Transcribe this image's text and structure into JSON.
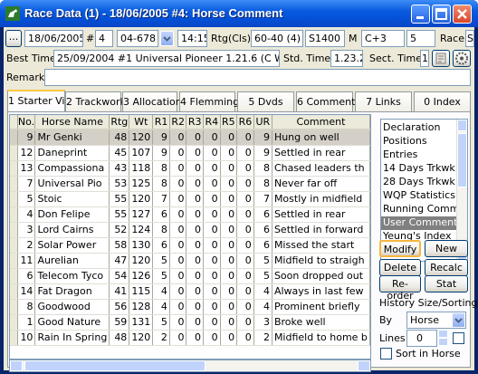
{
  "window": {
    "title": "Race Data (1) - 18/06/2005 #4: Horse Comment"
  },
  "toolbar": {
    "ellipsis": "...",
    "date": "18/06/2005",
    "hash_label": "#",
    "race_no": "4",
    "race_code": "04-678",
    "time": "14:15",
    "rtg_label": "Rtg(Cls)",
    "rtg_value": "60-40 (4)",
    "distance": "S1400",
    "m_label": "M",
    "class_code": "C+3",
    "field_5": "5",
    "race_label": "Race",
    "race_trunc": "S"
  },
  "besttime": {
    "label": "Best Time",
    "value": "25/09/2004 #1 Universal Pioneer 1.21.6 (C W Wor",
    "std_label": "Std. Time",
    "std_value": "1.23.2",
    "sect_label": "Sect. Time",
    "sect_value": "1"
  },
  "remark": {
    "label": "Remark",
    "value": ""
  },
  "tabs": [
    {
      "label": "1 Starter Vie",
      "active": true
    },
    {
      "label": "2 Trackwork",
      "active": false
    },
    {
      "label": "3 Allocation",
      "active": false
    },
    {
      "label": "4 Flemming",
      "active": false
    },
    {
      "label": "5 Dvds",
      "active": false
    },
    {
      "label": "6 Comment",
      "active": false
    },
    {
      "label": "7 Links",
      "active": false
    },
    {
      "label": "0 Index",
      "active": false
    }
  ],
  "table": {
    "columns": [
      "No.",
      "Horse Name",
      "Rtg",
      "Wt",
      "R1",
      "R2",
      "R3",
      "R4",
      "R5",
      "R6",
      "UR",
      "Comment"
    ],
    "rows": [
      [
        "9",
        "Mr Genki",
        "48",
        "120",
        "9",
        "0",
        "0",
        "0",
        "0",
        "0",
        "9",
        "Hung on well"
      ],
      [
        "12",
        "Daneprint",
        "45",
        "107",
        "9",
        "0",
        "0",
        "0",
        "0",
        "0",
        "9",
        "Settled in rear"
      ],
      [
        "13",
        "Compassiona",
        "43",
        "118",
        "8",
        "0",
        "0",
        "0",
        "0",
        "0",
        "8",
        "Chased leaders th"
      ],
      [
        "7",
        "Universal Pio",
        "53",
        "125",
        "8",
        "0",
        "0",
        "0",
        "0",
        "0",
        "8",
        "Never far off"
      ],
      [
        "5",
        "Stoic",
        "55",
        "120",
        "7",
        "0",
        "0",
        "0",
        "0",
        "0",
        "7",
        "Mostly in midfield"
      ],
      [
        "4",
        "Don Felipe",
        "55",
        "127",
        "6",
        "0",
        "0",
        "0",
        "0",
        "0",
        "6",
        "Settled in rear"
      ],
      [
        "3",
        "Lord Cairns",
        "52",
        "124",
        "8",
        "0",
        "0",
        "0",
        "0",
        "0",
        "6",
        "Settled in forward"
      ],
      [
        "2",
        "Solar Power",
        "58",
        "130",
        "6",
        "0",
        "0",
        "0",
        "0",
        "0",
        "6",
        "Missed the start"
      ],
      [
        "11",
        "Aurelian",
        "47",
        "120",
        "5",
        "0",
        "0",
        "0",
        "0",
        "0",
        "5",
        "Midfield to straigh"
      ],
      [
        "6",
        "Telecom Tyco",
        "54",
        "126",
        "5",
        "0",
        "0",
        "0",
        "0",
        "0",
        "5",
        "Soon dropped out"
      ],
      [
        "14",
        "Fat Dragon",
        "41",
        "115",
        "4",
        "0",
        "0",
        "0",
        "0",
        "0",
        "4",
        "Always in last few"
      ],
      [
        "8",
        "Goodwood",
        "56",
        "128",
        "4",
        "0",
        "0",
        "0",
        "0",
        "0",
        "4",
        "Prominent briefly"
      ],
      [
        "1",
        "Good Nature",
        "59",
        "131",
        "5",
        "0",
        "0",
        "0",
        "0",
        "0",
        "3",
        "Broke well"
      ],
      [
        "10",
        "Rain In Spring",
        "48",
        "120",
        "2",
        "0",
        "0",
        "0",
        "0",
        "0",
        "2",
        "Midfield to home b"
      ]
    ]
  },
  "side_list": {
    "items": [
      "Declaration",
      "Positions",
      "Entries",
      "14 Days Trkwk",
      "28 Days Trkwk",
      "WQP Statistics",
      "Running Comme",
      "User Comment",
      "Yeung's Index"
    ],
    "selected": "User Comment"
  },
  "buttons": {
    "modify": "Modify",
    "new": "New",
    "delete": "Delete",
    "recalc": "Recalc",
    "reorder": "Re-order",
    "stat": "Stat"
  },
  "history": {
    "label": "History Size/Sorting",
    "by_label": "By",
    "by_value": "Horse",
    "lines_label": "Lines",
    "lines_value": "0",
    "sort_label": "Sort in Horse"
  },
  "colors": {
    "title_bar": "#0a5be0",
    "face": "#ece9d8",
    "tab_highlight": "#ffc83c",
    "selection": "#808080"
  }
}
